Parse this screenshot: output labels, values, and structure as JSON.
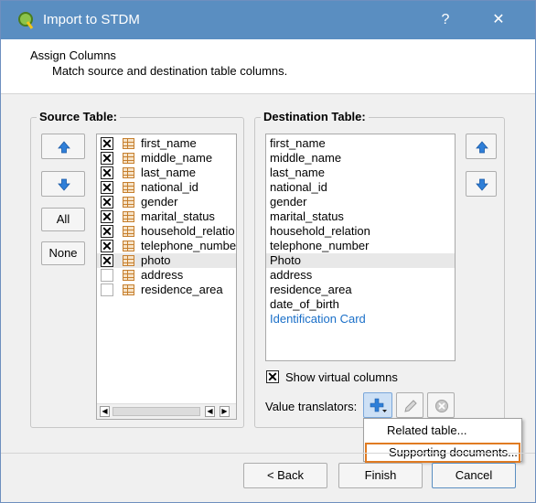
{
  "window": {
    "title": "Import to STDM",
    "help_label": "?",
    "close_label": "✕"
  },
  "header": {
    "title": "Assign Columns",
    "subtitle": "Match source and destination table columns."
  },
  "source": {
    "group_title": "Source Table:",
    "all_label": "All",
    "none_label": "None",
    "items": [
      {
        "label": "first_name",
        "checked": "✕"
      },
      {
        "label": "middle_name",
        "checked": "✕"
      },
      {
        "label": "last_name",
        "checked": "✕"
      },
      {
        "label": "national_id",
        "checked": "✕"
      },
      {
        "label": "gender",
        "checked": "✕"
      },
      {
        "label": "marital_status",
        "checked": "✕"
      },
      {
        "label": "household_relatio",
        "checked": "✕"
      },
      {
        "label": "telephone_numbe",
        "checked": "✕"
      },
      {
        "label": "photo",
        "checked": "✕"
      },
      {
        "label": "address",
        "checked": ""
      },
      {
        "label": "residence_area",
        "checked": ""
      }
    ]
  },
  "destination": {
    "group_title": "Destination Table:",
    "items": [
      "first_name",
      "middle_name",
      "last_name",
      "national_id",
      "gender",
      "marital_status",
      "household_relation",
      "telephone_number",
      "Photo",
      "address",
      "residence_area",
      "date_of_birth",
      "Identification Card"
    ],
    "show_virtual_label": "Show virtual columns",
    "show_virtual_checked": "✕",
    "value_translators_label": "Value translators:"
  },
  "popup_menu": {
    "items": [
      "Related table...",
      "Supporting documents..."
    ]
  },
  "buttons": {
    "back": "< Back",
    "finish": "Finish",
    "cancel": "Cancel"
  },
  "colors": {
    "titlebar": "#5a8ec1",
    "link": "#1a6fc8",
    "highlight": "#e07b22"
  }
}
